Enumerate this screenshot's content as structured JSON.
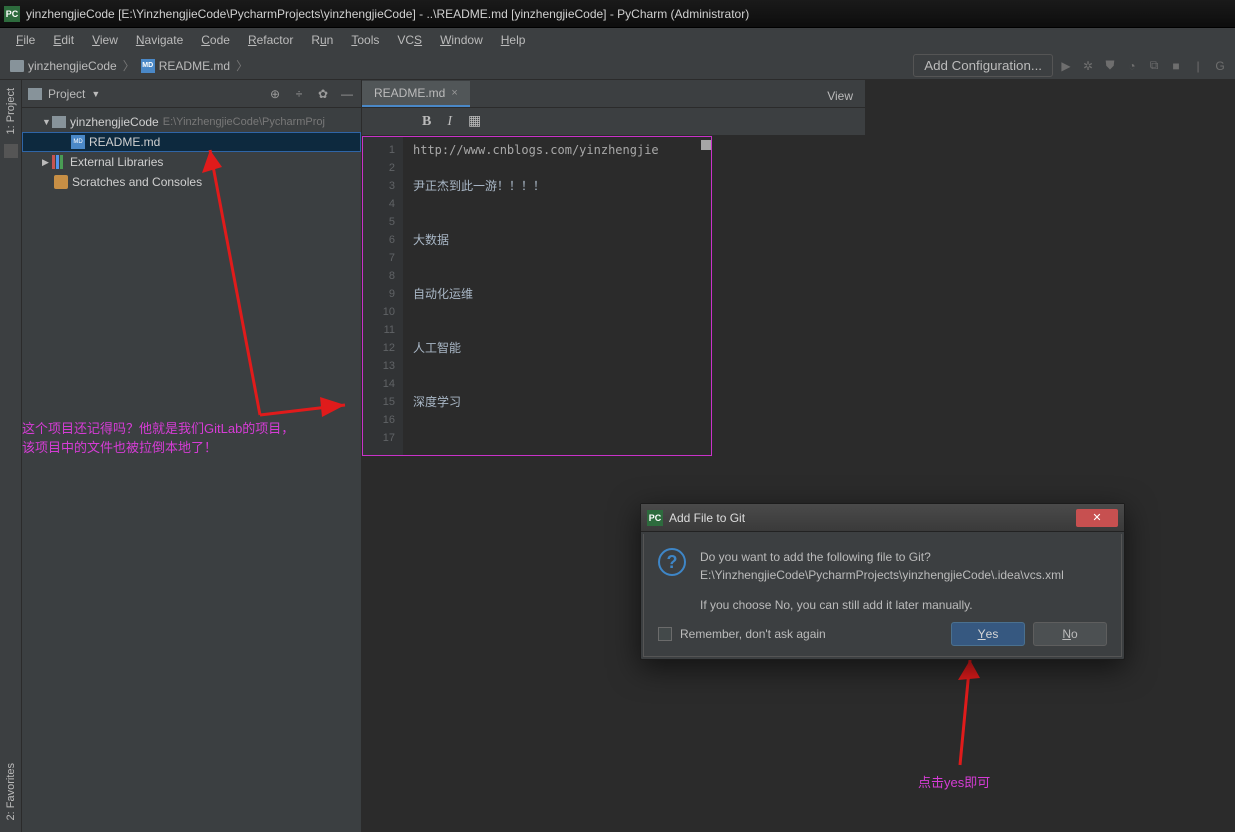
{
  "window": {
    "title": "yinzhengjieCode [E:\\YinzhengjieCode\\PycharmProjects\\yinzhengjieCode] - ..\\README.md [yinzhengjieCode] - PyCharm (Administrator)",
    "app_icon": "PC"
  },
  "menu": {
    "file": "File",
    "edit": "Edit",
    "view": "View",
    "navigate": "Navigate",
    "code": "Code",
    "refactor": "Refactor",
    "run": "Run",
    "tools": "Tools",
    "vcs": "VCS",
    "window": "Window",
    "help": "Help"
  },
  "nav": {
    "root": "yinzhengjieCode",
    "file": "README.md",
    "add_config": "Add Configuration...",
    "view_btn": "View"
  },
  "project": {
    "title": "Project",
    "left_tab": "1: Project",
    "favorites_tab": "2: Favorites",
    "root_name": "yinzhengjieCode",
    "root_path": "E:\\YinzhengjieCode\\PycharmProj",
    "file1": "README.md",
    "ext_libs": "External Libraries",
    "scratches": "Scratches and Consoles"
  },
  "editor": {
    "tab": "README.md",
    "lines": [
      "1",
      "2",
      "3",
      "4",
      "5",
      "6",
      "7",
      "8",
      "9",
      "10",
      "11",
      "12",
      "13",
      "14",
      "15",
      "16",
      "17"
    ],
    "content": {
      "l1": "http://www.cnblogs.com/yinzhengjie",
      "l3": "尹正杰到此一游！！！！",
      "l6": "大数据",
      "l9": "自动化运维",
      "l12": "人工智能",
      "l15": "深度学习"
    }
  },
  "annotation1_line1": "这个项目还记得吗？他就是我们GitLab的项目，",
  "annotation1_line2": "该项目中的文件也被拉倒本地了！",
  "annotation2": "点击yes即可",
  "dialog": {
    "title": "Add File to Git",
    "q1": "Do you want to add the following file to Git?",
    "path": "E:\\YinzhengjieCode\\PycharmProjects\\yinzhengjieCode\\.idea\\vcs.xml",
    "q2": "If you choose No, you can still add it later manually.",
    "remember": "Remember, don't ask again",
    "yes": "Yes",
    "no": "No"
  }
}
